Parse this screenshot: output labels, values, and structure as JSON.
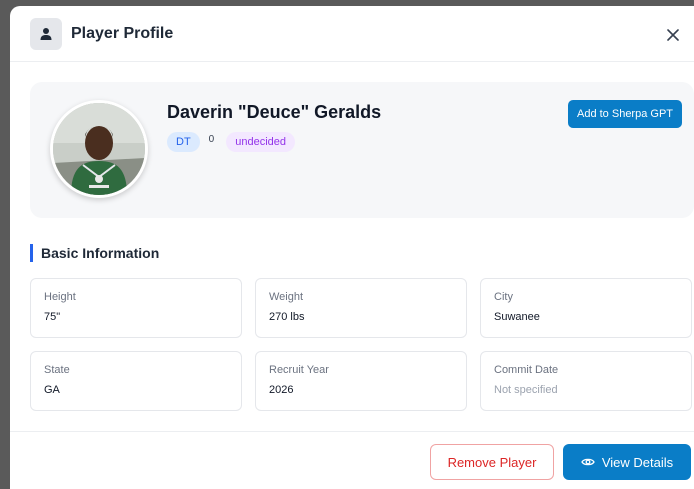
{
  "modal": {
    "title": "Player Profile",
    "header_icon": "user-icon",
    "close_icon": "close-icon"
  },
  "player": {
    "name": "Daverin \"Deuce\" Geralds",
    "position": "DT",
    "number": "0",
    "status": "undecided",
    "avatar": "player-photo"
  },
  "actions": {
    "sherpa_label": "Add to Sherpa GPT",
    "remove_label": "Remove Player",
    "view_label": "View Details",
    "view_icon": "eye-icon"
  },
  "basic_info": {
    "title": "Basic Information",
    "fields": [
      {
        "label": "Height",
        "value": "75\""
      },
      {
        "label": "Weight",
        "value": "270 lbs"
      },
      {
        "label": "City",
        "value": "Suwanee"
      },
      {
        "label": "State",
        "value": "GA"
      },
      {
        "label": "Recruit Year",
        "value": "2026"
      },
      {
        "label": "Commit Date",
        "value": "Not specified"
      }
    ]
  },
  "colors": {
    "accent": "#0a7dc7",
    "position_badge_bg": "#dbeafe",
    "status_badge_bg": "#f3e8ff",
    "danger": "#dc2626"
  }
}
